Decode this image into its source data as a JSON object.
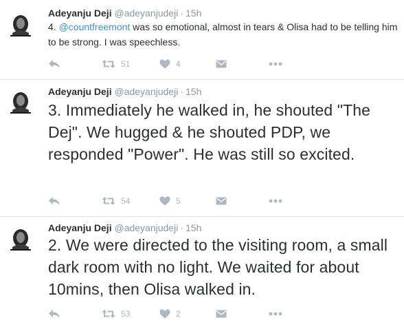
{
  "tweets": [
    {
      "author": "Adeyanju Deji",
      "handle": "@adeyanjudeji",
      "separator": "·",
      "time": "15h",
      "text_before": "4. ",
      "mention": "@countfreemont",
      "text_after": " was so emotional, almost in tears & Olisa had to be telling him to be strong. I was speechless.",
      "retweets": "51",
      "likes": "4"
    },
    {
      "author": "Adeyanju Deji",
      "handle": "@adeyanjudeji",
      "separator": "·",
      "time": "15h",
      "text": "3. Immediately he walked in, he shouted \"The Dej\". We hugged & he shouted PDP, we responded \"Power\". He was still so excited.",
      "retweets": "54",
      "likes": "5"
    },
    {
      "author": "Adeyanju Deji",
      "handle": "@adeyanjudeji",
      "separator": "·",
      "time": "15h",
      "text": "2. We were directed to the visiting room, a small dark room with no light. We waited for about 10mins, then Olisa walked in.",
      "retweets": "53",
      "likes": "2"
    }
  ],
  "icons": {
    "reply": "reply-icon",
    "retweet": "retweet-icon",
    "like": "heart-icon",
    "dm": "direct-message-icon",
    "more": "more-icon"
  },
  "colors": {
    "text": "#292f33",
    "muted": "#8899a6",
    "action": "#aab8c2",
    "link": "#3b94d9",
    "divider": "#e1e8ed"
  }
}
